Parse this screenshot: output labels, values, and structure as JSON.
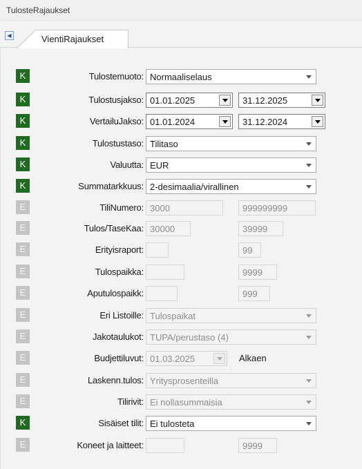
{
  "window": {
    "title": "TulosteRajaukset"
  },
  "tabs": [
    {
      "label": "VientiRajaukset"
    }
  ],
  "rows": {
    "tulostemuoto": {
      "badge": "K",
      "label": "Tulostemuoto:",
      "value": "Normaaliselaus"
    },
    "tulostusjakso": {
      "badge": "K",
      "label": "Tulostusjakso:",
      "start": "01.01.2025",
      "end": "31.12.2025"
    },
    "vertailujakso": {
      "badge": "K",
      "label": "VertailuJakso:",
      "start": "01.01.2024",
      "end": "31.12.2024"
    },
    "tulostustaso": {
      "badge": "K",
      "label": "Tulostustaso:",
      "value": "Tilitaso"
    },
    "valuutta": {
      "badge": "K",
      "label": "Valuutta:",
      "value": "EUR"
    },
    "summatarkkuus": {
      "badge": "K",
      "label": "Summatarkkuus:",
      "value": "2-desimaalia/virallinen"
    },
    "tilinumero": {
      "badge": "E",
      "label": "TiliNumero:",
      "from": "3000",
      "to": "999999999"
    },
    "tulostasekaa": {
      "badge": "E",
      "label": "Tulos/TaseKaa:",
      "from": "30000",
      "to": "39999"
    },
    "erityisraport": {
      "badge": "E",
      "label": "Erityisraport:",
      "from": "",
      "to": "99"
    },
    "tulospaikka": {
      "badge": "E",
      "label": "Tulospaikka:",
      "from": "",
      "to": "9999"
    },
    "aputulospaikk": {
      "badge": "E",
      "label": "Aputulospaikk:",
      "from": "",
      "to": "999"
    },
    "erilistoille": {
      "badge": "E",
      "label": "Eri Listoille:",
      "value": "Tulospaikat"
    },
    "jakotaulukot": {
      "badge": "E",
      "label": "Jakotaulukot:",
      "value": "TUPA/perustaso (4)"
    },
    "budjettiluvut": {
      "badge": "E",
      "label": "Budjettiluvut:",
      "date": "01.03.2025",
      "suffix": "Alkaen"
    },
    "laskenntulos": {
      "badge": "E",
      "label": "Laskenn.tulos:",
      "value": "Yritysprosenteilla"
    },
    "tilirivit": {
      "badge": "E",
      "label": "Tilirivit:",
      "value": "Ei nollasummaisia"
    },
    "sisaisettilit": {
      "badge": "K",
      "label": "Sisäiset tilit:",
      "value": "Ei tulosteta"
    },
    "koneetjalaitteet": {
      "badge": "E",
      "label": "Koneet ja laitteet:",
      "from": "",
      "to": "9999"
    }
  },
  "colors": {
    "badge_k": "#1f6b1f",
    "badge_e": "#c4c4c4"
  }
}
